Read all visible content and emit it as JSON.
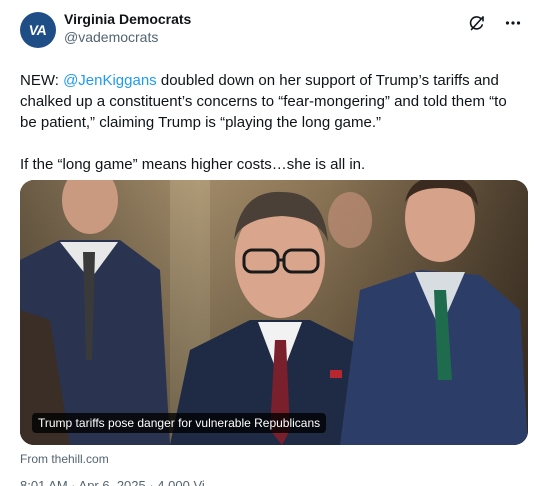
{
  "author": {
    "avatar_initials": "VA",
    "display_name": "Virginia Democrats",
    "handle": "@vademocrats"
  },
  "header": {
    "grok_icon": "grok-icon",
    "more_icon": "more-icon"
  },
  "tweet": {
    "text_before_mention": "NEW: ",
    "mention": "@JenKiggans",
    "text_after_mention": " doubled down on her support of Trump’s tariffs and chalked up a constituent’s concerns to “fear-mongering” and told them “to be patient,” claiming Trump is “playing the long game.”\n\nIf the “long game” means higher costs…she is all in."
  },
  "media": {
    "caption": "Trump tariffs pose danger for vulnerable Republicans",
    "source": "From thehill.com"
  },
  "meta": {
    "partial_text": "8:01 AM · Apr 6, 2025 · 4,000 Vi"
  },
  "colors": {
    "link": "#1d9bf0",
    "secondary_text": "#536471",
    "avatar_bg": "#1f4e86"
  }
}
